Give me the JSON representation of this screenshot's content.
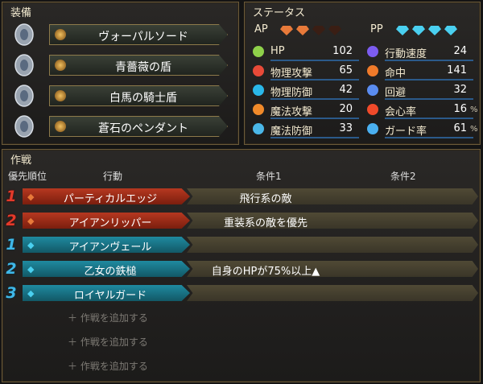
{
  "equipment": {
    "title": "装備",
    "items": [
      {
        "name": "ヴォーパルソード",
        "icon": "sword-icon",
        "sub_icon": "sword-sub-icon"
      },
      {
        "name": "青薔薇の盾",
        "icon": "shield-icon",
        "sub_icon": "ring-sub-icon"
      },
      {
        "name": "白馬の騎士盾",
        "icon": "shield-icon",
        "sub_icon": "ring-sub-icon"
      },
      {
        "name": "蒼石のペンダント",
        "icon": "pendant-icon",
        "sub_icon": "ring-sub-icon"
      }
    ]
  },
  "status": {
    "title": "ステータス",
    "ap_label": "AP",
    "pp_label": "PP",
    "ap_filled": 2,
    "ap_total": 4,
    "pp_filled": 4,
    "pp_total": 4,
    "stats_left": [
      {
        "label": "HP",
        "value": "102",
        "icon": "heart-icon",
        "color": "#8fd14a"
      },
      {
        "label": "物理攻撃",
        "value": "65",
        "icon": "sword-icon",
        "color": "#e84a38"
      },
      {
        "label": "物理防御",
        "value": "42",
        "icon": "armor-icon",
        "color": "#2ab7e8"
      },
      {
        "label": "魔法攻撃",
        "value": "20",
        "icon": "wand-icon",
        "color": "#f08a2a"
      },
      {
        "label": "魔法防御",
        "value": "33",
        "icon": "magic-shield-icon",
        "color": "#4ab7e8"
      }
    ],
    "stats_right": [
      {
        "label": "行動速度",
        "value": "24",
        "unit": "",
        "icon": "speed-icon",
        "color": "#7c5cf0"
      },
      {
        "label": "命中",
        "value": "141",
        "unit": "",
        "icon": "target-icon",
        "color": "#f07a2a"
      },
      {
        "label": "回避",
        "value": "32",
        "unit": "",
        "icon": "evade-icon",
        "color": "#5a8cf0"
      },
      {
        "label": "会心率",
        "value": "16",
        "unit": "%",
        "icon": "critical-icon",
        "color": "#f04a2a"
      },
      {
        "label": "ガード率",
        "value": "61",
        "unit": "%",
        "icon": "guard-icon",
        "color": "#4ab0f0"
      }
    ]
  },
  "tactics": {
    "title": "作戦",
    "headers": {
      "priority": "優先順位",
      "action": "行動",
      "cond1": "条件1",
      "cond2": "条件2"
    },
    "rows": [
      {
        "priority": "1",
        "kind": "red",
        "action": "パーティカルエッジ",
        "cond1": "飛行系の敵",
        "cond1_icon": "wing-icon",
        "cond2": ""
      },
      {
        "priority": "2",
        "kind": "red",
        "action": "アイアンリッパー",
        "cond1": "重装系の敵を優先",
        "cond1_icon": "heavy-icon",
        "cond2": ""
      },
      {
        "priority": "1",
        "kind": "blue",
        "action": "アイアンヴェール",
        "cond1": "",
        "cond1_icon": "",
        "cond2": ""
      },
      {
        "priority": "2",
        "kind": "blue",
        "action": "乙女の鉄槌",
        "cond1": "自身のHPが75%以上▲",
        "cond1_icon": "",
        "cond2": ""
      },
      {
        "priority": "3",
        "kind": "blue",
        "action": "ロイヤルガード",
        "cond1": "",
        "cond1_icon": "",
        "cond2": ""
      }
    ],
    "add_label": "＋ 作戦を追加する",
    "add_count": 3
  },
  "colors": {
    "ap_gem": "#e87a3a",
    "pp_gem": "#4ad0f0",
    "gold_border": "#8d7a4a"
  }
}
